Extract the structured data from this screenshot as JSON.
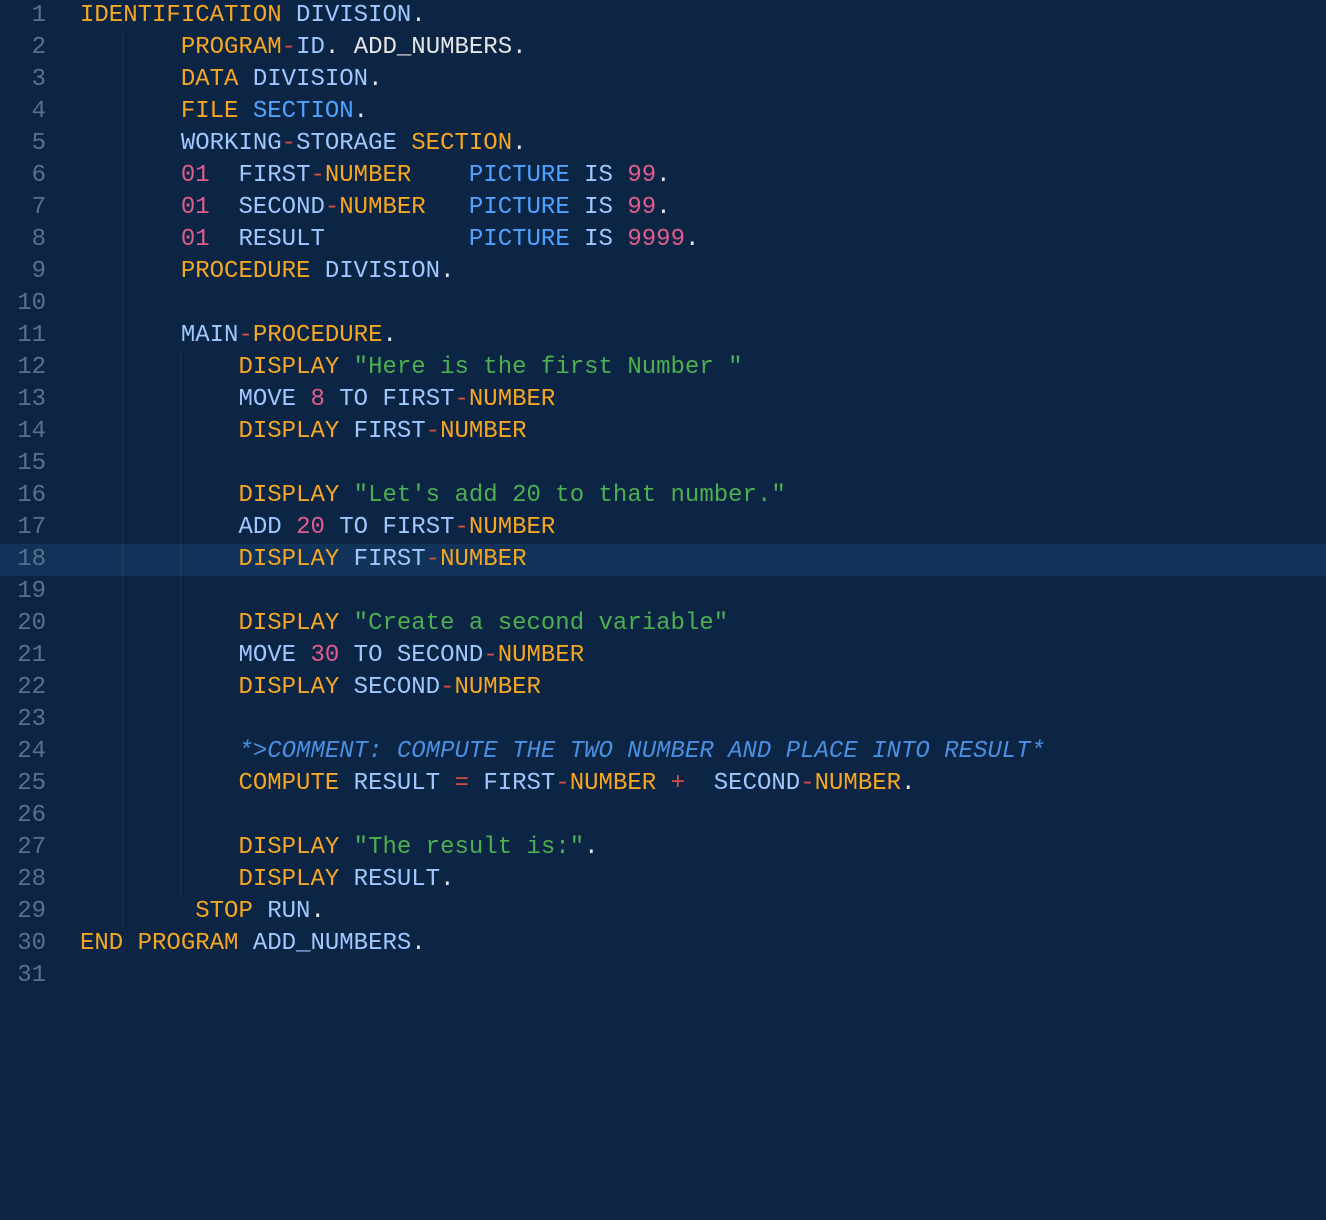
{
  "editor": {
    "highlighted_line": 18,
    "lines": [
      {
        "n": 1,
        "indent": 0,
        "tokens": [
          {
            "t": "IDENTIFICATION",
            "c": "tk-keyword"
          },
          {
            "t": " ",
            "c": "tk-default"
          },
          {
            "t": "DIVISION",
            "c": "tk-paleblue"
          },
          {
            "t": ".",
            "c": "tk-default"
          }
        ]
      },
      {
        "n": 2,
        "indent": 1,
        "tokens": [
          {
            "t": "PROGRAM",
            "c": "tk-keyword"
          },
          {
            "t": "-",
            "c": "tk-op"
          },
          {
            "t": "ID",
            "c": "tk-paleblue"
          },
          {
            "t": ". ",
            "c": "tk-default"
          },
          {
            "t": "ADD_NUMBERS",
            "c": "tk-default"
          },
          {
            "t": ".",
            "c": "tk-default"
          }
        ]
      },
      {
        "n": 3,
        "indent": 1,
        "tokens": [
          {
            "t": "DATA",
            "c": "tk-keyword"
          },
          {
            "t": " ",
            "c": "tk-default"
          },
          {
            "t": "DIVISION",
            "c": "tk-paleblue"
          },
          {
            "t": ".",
            "c": "tk-default"
          }
        ]
      },
      {
        "n": 4,
        "indent": 1,
        "tokens": [
          {
            "t": "FILE",
            "c": "tk-keyword"
          },
          {
            "t": " ",
            "c": "tk-default"
          },
          {
            "t": "SECTION",
            "c": "tk-blue"
          },
          {
            "t": ".",
            "c": "tk-default"
          }
        ]
      },
      {
        "n": 5,
        "indent": 1,
        "tokens": [
          {
            "t": "WORKING",
            "c": "tk-paleblue"
          },
          {
            "t": "-",
            "c": "tk-op"
          },
          {
            "t": "STORAGE ",
            "c": "tk-paleblue"
          },
          {
            "t": "SECTION",
            "c": "tk-keyword"
          },
          {
            "t": ".",
            "c": "tk-default"
          }
        ]
      },
      {
        "n": 6,
        "indent": 1,
        "tokens": [
          {
            "t": "01",
            "c": "tk-number"
          },
          {
            "t": "  ",
            "c": "tk-default"
          },
          {
            "t": "FIRST",
            "c": "tk-paleblue"
          },
          {
            "t": "-",
            "c": "tk-op"
          },
          {
            "t": "NUMBER",
            "c": "tk-keyword"
          },
          {
            "t": "    ",
            "c": "tk-default"
          },
          {
            "t": "PICTURE",
            "c": "tk-blue"
          },
          {
            "t": " ",
            "c": "tk-default"
          },
          {
            "t": "IS",
            "c": "tk-paleblue"
          },
          {
            "t": " ",
            "c": "tk-default"
          },
          {
            "t": "99",
            "c": "tk-number"
          },
          {
            "t": ".",
            "c": "tk-default"
          }
        ]
      },
      {
        "n": 7,
        "indent": 1,
        "tokens": [
          {
            "t": "01",
            "c": "tk-number"
          },
          {
            "t": "  ",
            "c": "tk-default"
          },
          {
            "t": "SECOND",
            "c": "tk-paleblue"
          },
          {
            "t": "-",
            "c": "tk-op"
          },
          {
            "t": "NUMBER",
            "c": "tk-keyword"
          },
          {
            "t": "   ",
            "c": "tk-default"
          },
          {
            "t": "PICTURE",
            "c": "tk-blue"
          },
          {
            "t": " ",
            "c": "tk-default"
          },
          {
            "t": "IS",
            "c": "tk-paleblue"
          },
          {
            "t": " ",
            "c": "tk-default"
          },
          {
            "t": "99",
            "c": "tk-number"
          },
          {
            "t": ".",
            "c": "tk-default"
          }
        ]
      },
      {
        "n": 8,
        "indent": 1,
        "tokens": [
          {
            "t": "01",
            "c": "tk-number"
          },
          {
            "t": "  ",
            "c": "tk-default"
          },
          {
            "t": "RESULT",
            "c": "tk-paleblue"
          },
          {
            "t": "          ",
            "c": "tk-default"
          },
          {
            "t": "PICTURE",
            "c": "tk-blue"
          },
          {
            "t": " ",
            "c": "tk-default"
          },
          {
            "t": "IS",
            "c": "tk-paleblue"
          },
          {
            "t": " ",
            "c": "tk-default"
          },
          {
            "t": "9999",
            "c": "tk-number"
          },
          {
            "t": ".",
            "c": "tk-default"
          }
        ]
      },
      {
        "n": 9,
        "indent": 1,
        "tokens": [
          {
            "t": "PROCEDURE",
            "c": "tk-keyword"
          },
          {
            "t": " ",
            "c": "tk-default"
          },
          {
            "t": "DIVISION",
            "c": "tk-paleblue"
          },
          {
            "t": ".",
            "c": "tk-default"
          }
        ]
      },
      {
        "n": 10,
        "indent": 1,
        "tokens": []
      },
      {
        "n": 11,
        "indent": 1,
        "tokens": [
          {
            "t": "MAIN",
            "c": "tk-paleblue"
          },
          {
            "t": "-",
            "c": "tk-op"
          },
          {
            "t": "PROCEDURE",
            "c": "tk-keyword"
          },
          {
            "t": ".",
            "c": "tk-default"
          }
        ]
      },
      {
        "n": 12,
        "indent": 2,
        "tokens": [
          {
            "t": "DISPLAY",
            "c": "tk-keyword"
          },
          {
            "t": " ",
            "c": "tk-default"
          },
          {
            "t": "\"Here is the first Number \"",
            "c": "tk-string"
          }
        ]
      },
      {
        "n": 13,
        "indent": 2,
        "tokens": [
          {
            "t": "MOVE",
            "c": "tk-paleblue"
          },
          {
            "t": " ",
            "c": "tk-default"
          },
          {
            "t": "8",
            "c": "tk-number"
          },
          {
            "t": " ",
            "c": "tk-default"
          },
          {
            "t": "TO",
            "c": "tk-paleblue"
          },
          {
            "t": " ",
            "c": "tk-default"
          },
          {
            "t": "FIRST",
            "c": "tk-paleblue"
          },
          {
            "t": "-",
            "c": "tk-op"
          },
          {
            "t": "NUMBER",
            "c": "tk-keyword"
          }
        ]
      },
      {
        "n": 14,
        "indent": 2,
        "tokens": [
          {
            "t": "DISPLAY",
            "c": "tk-keyword"
          },
          {
            "t": " ",
            "c": "tk-default"
          },
          {
            "t": "FIRST",
            "c": "tk-paleblue"
          },
          {
            "t": "-",
            "c": "tk-op"
          },
          {
            "t": "NUMBER",
            "c": "tk-keyword"
          }
        ]
      },
      {
        "n": 15,
        "indent": 2,
        "tokens": []
      },
      {
        "n": 16,
        "indent": 2,
        "tokens": [
          {
            "t": "DISPLAY",
            "c": "tk-keyword"
          },
          {
            "t": " ",
            "c": "tk-default"
          },
          {
            "t": "\"Let's add 20 to that number.\"",
            "c": "tk-string"
          }
        ]
      },
      {
        "n": 17,
        "indent": 2,
        "tokens": [
          {
            "t": "ADD",
            "c": "tk-paleblue"
          },
          {
            "t": " ",
            "c": "tk-default"
          },
          {
            "t": "20",
            "c": "tk-number"
          },
          {
            "t": " ",
            "c": "tk-default"
          },
          {
            "t": "TO",
            "c": "tk-paleblue"
          },
          {
            "t": " ",
            "c": "tk-default"
          },
          {
            "t": "FIRST",
            "c": "tk-paleblue"
          },
          {
            "t": "-",
            "c": "tk-op"
          },
          {
            "t": "NUMBER",
            "c": "tk-keyword"
          }
        ]
      },
      {
        "n": 18,
        "indent": 2,
        "tokens": [
          {
            "t": "DISPLAY",
            "c": "tk-keyword"
          },
          {
            "t": " ",
            "c": "tk-default"
          },
          {
            "t": "FIRST",
            "c": "tk-paleblue"
          },
          {
            "t": "-",
            "c": "tk-op"
          },
          {
            "t": "NUMBER",
            "c": "tk-keyword"
          }
        ]
      },
      {
        "n": 19,
        "indent": 2,
        "tokens": []
      },
      {
        "n": 20,
        "indent": 2,
        "tokens": [
          {
            "t": "DISPLAY",
            "c": "tk-keyword"
          },
          {
            "t": " ",
            "c": "tk-default"
          },
          {
            "t": "\"Create a second variable\"",
            "c": "tk-string"
          }
        ]
      },
      {
        "n": 21,
        "indent": 2,
        "tokens": [
          {
            "t": "MOVE",
            "c": "tk-paleblue"
          },
          {
            "t": " ",
            "c": "tk-default"
          },
          {
            "t": "30",
            "c": "tk-number"
          },
          {
            "t": " ",
            "c": "tk-default"
          },
          {
            "t": "TO",
            "c": "tk-paleblue"
          },
          {
            "t": " ",
            "c": "tk-default"
          },
          {
            "t": "SECOND",
            "c": "tk-paleblue"
          },
          {
            "t": "-",
            "c": "tk-op"
          },
          {
            "t": "NUMBER",
            "c": "tk-keyword"
          }
        ]
      },
      {
        "n": 22,
        "indent": 2,
        "tokens": [
          {
            "t": "DISPLAY",
            "c": "tk-keyword"
          },
          {
            "t": " ",
            "c": "tk-default"
          },
          {
            "t": "SECOND",
            "c": "tk-paleblue"
          },
          {
            "t": "-",
            "c": "tk-op"
          },
          {
            "t": "NUMBER",
            "c": "tk-keyword"
          }
        ]
      },
      {
        "n": 23,
        "indent": 2,
        "tokens": []
      },
      {
        "n": 24,
        "indent": 2,
        "tokens": [
          {
            "t": "*>COMMENT: COMPUTE THE TWO NUMBER AND PLACE INTO RESULT*",
            "c": "tk-comment"
          }
        ]
      },
      {
        "n": 25,
        "indent": 2,
        "tokens": [
          {
            "t": "COMPUTE",
            "c": "tk-keyword"
          },
          {
            "t": " ",
            "c": "tk-default"
          },
          {
            "t": "RESULT",
            "c": "tk-paleblue"
          },
          {
            "t": " ",
            "c": "tk-default"
          },
          {
            "t": "=",
            "c": "tk-op"
          },
          {
            "t": " ",
            "c": "tk-default"
          },
          {
            "t": "FIRST",
            "c": "tk-paleblue"
          },
          {
            "t": "-",
            "c": "tk-op"
          },
          {
            "t": "NUMBER",
            "c": "tk-keyword"
          },
          {
            "t": " ",
            "c": "tk-default"
          },
          {
            "t": "+",
            "c": "tk-op"
          },
          {
            "t": "  ",
            "c": "tk-default"
          },
          {
            "t": "SECOND",
            "c": "tk-paleblue"
          },
          {
            "t": "-",
            "c": "tk-op"
          },
          {
            "t": "NUMBER",
            "c": "tk-keyword"
          },
          {
            "t": ".",
            "c": "tk-default"
          }
        ]
      },
      {
        "n": 26,
        "indent": 2,
        "tokens": []
      },
      {
        "n": 27,
        "indent": 2,
        "tokens": [
          {
            "t": "DISPLAY",
            "c": "tk-keyword"
          },
          {
            "t": " ",
            "c": "tk-default"
          },
          {
            "t": "\"The result is:\"",
            "c": "tk-string"
          },
          {
            "t": ".",
            "c": "tk-default"
          }
        ]
      },
      {
        "n": 28,
        "indent": 2,
        "tokens": [
          {
            "t": "DISPLAY",
            "c": "tk-keyword"
          },
          {
            "t": " ",
            "c": "tk-default"
          },
          {
            "t": "RESULT",
            "c": "tk-paleblue"
          },
          {
            "t": ".",
            "c": "tk-default"
          }
        ]
      },
      {
        "n": 29,
        "indent": 1,
        "tokens": [
          {
            "t": " ",
            "c": "tk-default"
          },
          {
            "t": "STOP",
            "c": "tk-keyword"
          },
          {
            "t": " ",
            "c": "tk-default"
          },
          {
            "t": "RUN",
            "c": "tk-paleblue"
          },
          {
            "t": ".",
            "c": "tk-default"
          }
        ]
      },
      {
        "n": 30,
        "indent": 0,
        "tokens": [
          {
            "t": "END",
            "c": "tk-keyword"
          },
          {
            "t": " ",
            "c": "tk-default"
          },
          {
            "t": "PROGRAM",
            "c": "tk-keyword"
          },
          {
            "t": " ",
            "c": "tk-default"
          },
          {
            "t": "ADD_NUMBERS",
            "c": "tk-paleblue"
          },
          {
            "t": ".",
            "c": "tk-default"
          }
        ]
      },
      {
        "n": 31,
        "indent": 0,
        "tokens": []
      }
    ]
  }
}
